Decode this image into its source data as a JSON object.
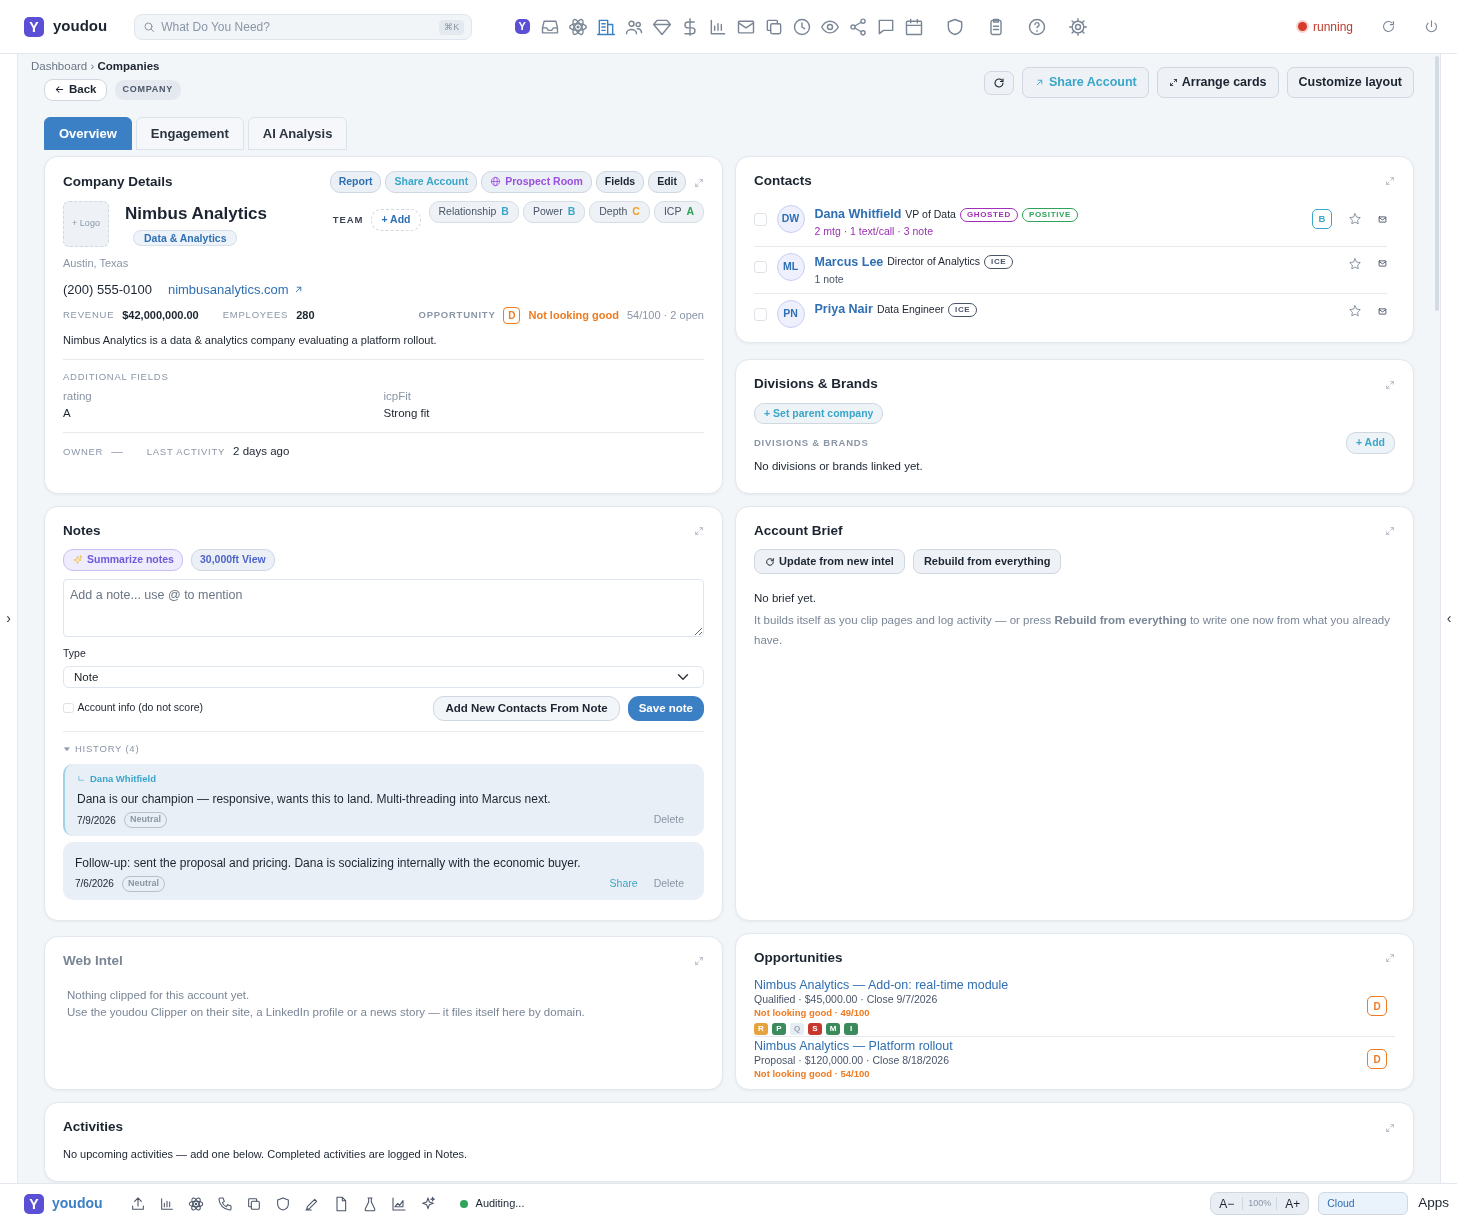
{
  "app": {
    "logo_letter": "Y",
    "brand": "youdou",
    "search_placeholder": "What Do You Need?",
    "search_shortcut": "⌘K",
    "nav_icons": [
      {
        "kind": "logo",
        "letter": "Y",
        "selected": false
      },
      {
        "kind": "inbox",
        "selected": false
      },
      {
        "kind": "atom",
        "selected": false
      },
      {
        "kind": "building",
        "selected": true
      },
      {
        "kind": "people",
        "selected": false
      },
      {
        "kind": "diamond",
        "selected": false
      },
      {
        "kind": "dollar",
        "selected": false
      },
      {
        "kind": "bars",
        "selected": false
      },
      {
        "kind": "mail",
        "selected": false
      },
      {
        "kind": "copy",
        "selected": false
      },
      {
        "kind": "clock",
        "selected": false
      },
      {
        "kind": "eye",
        "selected": false
      },
      {
        "kind": "share",
        "selected": false
      },
      {
        "kind": "chat",
        "selected": false
      },
      {
        "kind": "calendar",
        "selected": false
      },
      {
        "kind": "shield",
        "selected": false
      },
      {
        "kind": "clipboard",
        "selected": false
      },
      {
        "kind": "question",
        "selected": false
      },
      {
        "kind": "gear",
        "selected": false
      }
    ],
    "status": "running",
    "left_toggle": "›",
    "right_toggle": "‹"
  },
  "breadcrumb": [
    "Dashboard",
    "Companies"
  ],
  "breadcrumb_separator": "›",
  "back_label": "Back",
  "entity_badge": "COMPANY",
  "header_buttons": [
    {
      "label": "Share Account",
      "kind": "share"
    },
    {
      "label": "Arrange cards",
      "kind": "arrange"
    },
    {
      "label": "Customize layout",
      "kind": "plain"
    }
  ],
  "tabs": [
    {
      "label": "Overview",
      "selected": true
    },
    {
      "label": "Engagement",
      "selected": false
    },
    {
      "label": "AI Analysis",
      "selected": false
    }
  ],
  "company_details": {
    "title": "Company Details",
    "actions": [
      {
        "label": "Report",
        "kind": "primary"
      },
      {
        "label": "Share Account",
        "kind": "info"
      },
      {
        "label": "Prospect Room",
        "kind": "room"
      },
      {
        "label": "Fields",
        "kind": "dark"
      },
      {
        "label": "Edit",
        "kind": "dark"
      }
    ],
    "logo_label": "+ Logo",
    "name": "Nimbus Analytics",
    "industry": "Data & Analytics",
    "team_label": "TEAM",
    "team_add": "+ Add",
    "scores": [
      {
        "label": "Relationship",
        "grade": "B",
        "color": "#3aa6c9"
      },
      {
        "label": "Power",
        "grade": "B",
        "color": "#3aa6c9"
      },
      {
        "label": "Depth",
        "grade": "C",
        "color": "#f0a020"
      },
      {
        "label": "ICP",
        "grade": "A",
        "color": "#2fa35a"
      }
    ],
    "location": "Austin, Texas",
    "phone": "(200) 555-0100",
    "website": "nimbusanalytics.com",
    "revenue_label": "REVENUE",
    "revenue": "$42,000,000.00",
    "employees_label": "EMPLOYEES",
    "employees": "280",
    "opportunity_label": "OPPORTUNITY",
    "opportunity_grade": "D",
    "opportunity_status": "Not looking good",
    "opportunity_score": "54/100 · 2 open",
    "description": "Nimbus Analytics is a data & analytics company evaluating a platform rollout.",
    "additional_label": "ADDITIONAL FIELDS",
    "fields": [
      {
        "label": "rating",
        "value": "A"
      },
      {
        "label": "icpFit",
        "value": "Strong fit"
      }
    ],
    "owner_label": "OWNER",
    "owner_value": "—",
    "last_activity_label": "LAST ACTIVITY",
    "last_activity": "2 days ago"
  },
  "contacts": {
    "title": "Contacts",
    "items": [
      {
        "initials": "DW",
        "name": "Dana Whitfield",
        "role": "VP of Data",
        "tags": [
          {
            "label": "GHOSTED",
            "color": "#a12fb8"
          },
          {
            "label": "POSITIVE",
            "color": "#2fa35a"
          }
        ],
        "meta": "2 mtg · 1 text/call · 3 note",
        "engaged": true,
        "grade": "B",
        "checked": false,
        "starred": false
      },
      {
        "initials": "ML",
        "name": "Marcus Lee",
        "role": "Director of Analytics",
        "tags": [
          {
            "label": "ICE",
            "color": "#4a5568"
          }
        ],
        "meta": "1 note",
        "engaged": false,
        "checked": false,
        "starred": false
      },
      {
        "initials": "PN",
        "name": "Priya Nair",
        "role": "Data Engineer",
        "tags": [
          {
            "label": "ICE",
            "color": "#4a5568"
          }
        ],
        "checked": false,
        "starred": false
      }
    ]
  },
  "divisions": {
    "title": "Divisions & Brands",
    "set_parent": "+ Set parent company",
    "section_label": "DIVISIONS & BRANDS",
    "add": "+ Add",
    "empty": "No divisions or brands linked yet."
  },
  "notes": {
    "title": "Notes",
    "actions": [
      {
        "label": "Summarize notes",
        "kind": "ai"
      },
      {
        "label": "30,000ft View",
        "kind": "plain"
      }
    ],
    "placeholder": "Add a note... use @ to mention",
    "type_label": "Type",
    "type_value": "Note",
    "account_info_label": "Account info (do not score)",
    "account_info_checked": false,
    "add_contacts": "Add New Contacts From Note",
    "save": "Save note",
    "history_label": "HISTORY (4)",
    "history_expanded": true,
    "history": [
      {
        "mention": "Dana Whitfield",
        "text": "Dana is our champion — responsive, wants this to land. Multi-threading into Marcus next.",
        "date": "7/9/2026",
        "sentiment": "Neutral",
        "actions": [
          {
            "label": "Delete",
            "kind": "delete"
          }
        ]
      },
      {
        "text": "Follow-up: sent the proposal and pricing. Dana is socializing internally with the economic buyer.",
        "date": "7/6/2026",
        "sentiment": "Neutral",
        "actions": [
          {
            "label": "Share",
            "kind": "share"
          },
          {
            "label": "Delete",
            "kind": "delete"
          }
        ]
      }
    ]
  },
  "account_brief": {
    "title": "Account Brief",
    "buttons": [
      {
        "label": "Update from new intel",
        "kind": "refresh"
      },
      {
        "label": "Rebuild from everything",
        "kind": "plain"
      }
    ],
    "empty_title": "No brief yet.",
    "empty_text": "It builds itself as you clip pages and log activity — or press **Rebuild from everything** to write one now from what you already have."
  },
  "web_intel": {
    "title": "Web Intel",
    "empty_title": "Nothing clipped for this account yet.",
    "empty_text": "Use the youdou Clipper on their site, a LinkedIn profile or a news story — it files itself here by domain."
  },
  "opportunities": {
    "title": "Opportunities",
    "items": [
      {
        "name": "Nimbus Analytics — Add-on: real-time module",
        "meta": "Qualified · $45,000.00 · Close 9/7/2026",
        "health": "Not looking good · 49/100",
        "grade": "D",
        "letters": [
          {
            "label": "R",
            "filled": true,
            "color": "#e6a23c"
          },
          {
            "label": "P",
            "filled": true,
            "color": "#3a8a5c"
          },
          {
            "label": "Q",
            "filled": false,
            "color": "#e6ecf3"
          },
          {
            "label": "S",
            "filled": true,
            "color": "#c8372d"
          },
          {
            "label": "M",
            "filled": true,
            "color": "#3a8a5c"
          },
          {
            "label": "I",
            "filled": true,
            "color": "#3a8a5c"
          }
        ]
      },
      {
        "name": "Nimbus Analytics — Platform rollout",
        "meta": "Proposal · $120,000.00 · Close 8/18/2026",
        "health": "Not looking good · 54/100",
        "grade": "D"
      }
    ]
  },
  "activities": {
    "title": "Activities",
    "empty": "No upcoming activities — add one below. Completed activities are logged in Notes."
  },
  "bottom_bar": {
    "logo_letter": "Y",
    "brand": "youdou",
    "status": "Auditing...",
    "font_decrease": "A−",
    "zoom": "100%",
    "font_increase": "A+",
    "environment": "Cloud",
    "apps": "Apps"
  }
}
